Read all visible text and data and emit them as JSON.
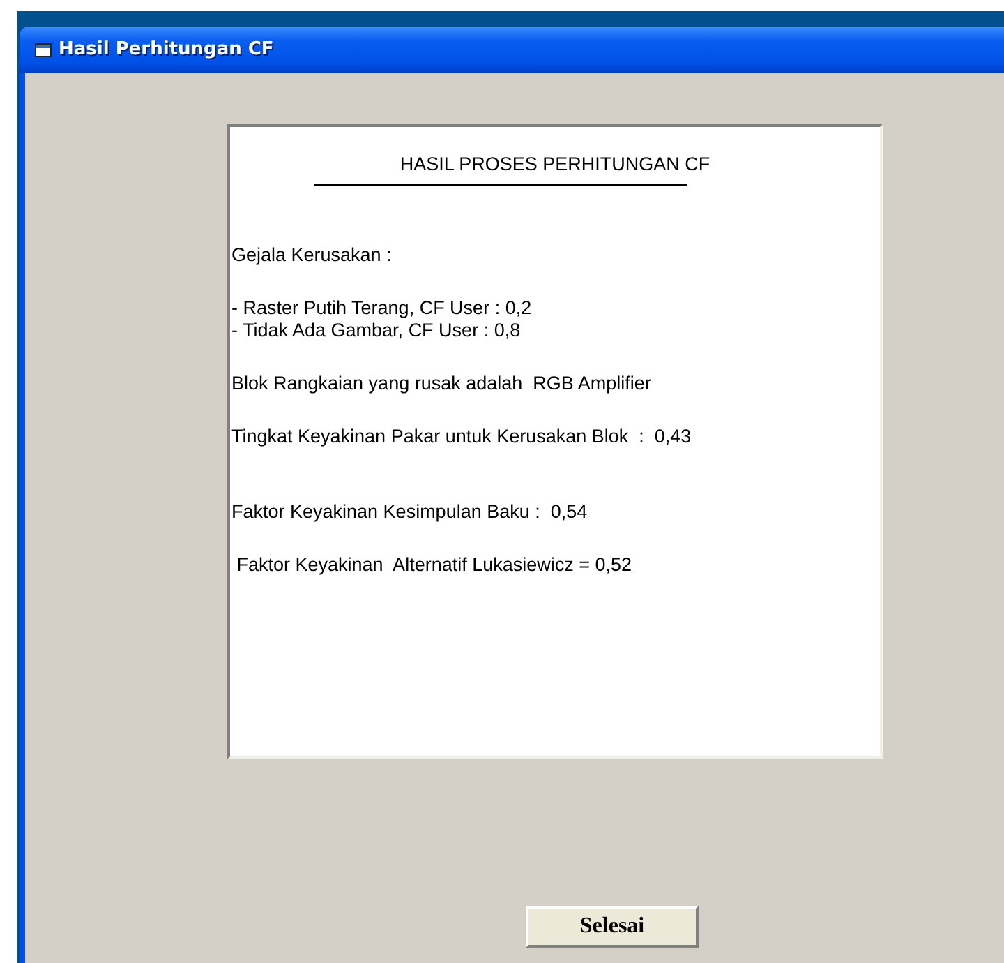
{
  "window": {
    "title": "Hasil Perhitungan CF"
  },
  "result": {
    "heading": "HASIL PROSES PERHITUNGAN CF",
    "paragraphs": [
      [
        "Gejala Kerusakan :"
      ],
      [
        "- Raster Putih Terang, CF User : 0,2",
        "- Tidak Ada Gambar, CF User : 0,8"
      ],
      [
        "Blok Rangkaian yang rusak adalah  RGB Amplifier"
      ],
      [
        "Tingkat Keyakinan Pakar untuk Kerusakan Blok  :  0,43"
      ],
      [
        "Faktor Keyakinan Kesimpulan Baku :  0,54"
      ],
      [
        " Faktor Keyakinan  Alternatif Lukasiewicz = 0,52"
      ]
    ]
  },
  "buttons": [
    "Selesai"
  ]
}
